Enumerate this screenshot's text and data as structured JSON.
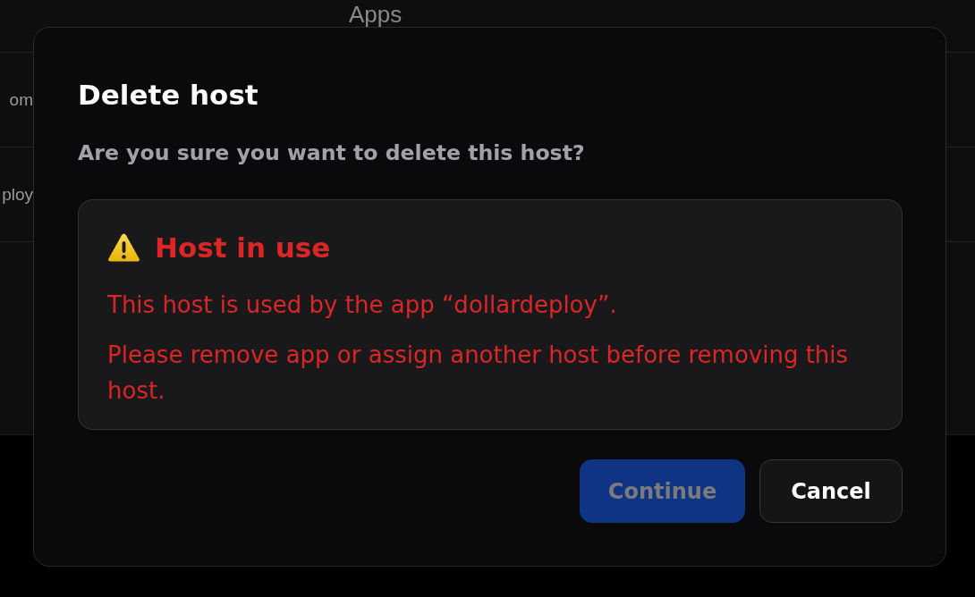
{
  "background_page": {
    "column_header": "Apps",
    "rows": [
      {
        "column_1": "om"
      },
      {
        "column_1": "ploy"
      }
    ]
  },
  "dialog": {
    "title": "Delete host",
    "message": "Are you sure you want to delete this host?",
    "alert": {
      "kind": "warning",
      "title": "Host in use",
      "paragraphs": [
        "This host is used by the app “dollardeploy”.",
        "Please remove app or assign another host before removing this host."
      ]
    },
    "buttons": [
      {
        "label": "Continue",
        "kind": "primary",
        "disabled": true
      },
      {
        "label": "Cancel",
        "kind": "secondary",
        "disabled": false
      }
    ]
  }
}
